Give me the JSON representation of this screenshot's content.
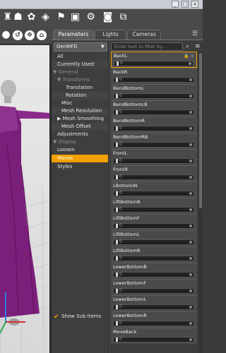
{
  "window_buttons": [
    "_",
    "□",
    "×"
  ],
  "tabs": [
    {
      "label": "Parameters"
    },
    {
      "label": "Lights"
    },
    {
      "label": "Cameras"
    }
  ],
  "figure_dropdown": "GenMFD",
  "categories": [
    {
      "label": "All"
    },
    {
      "label": "Currently Used"
    },
    {
      "label": "▼ General"
    },
    {
      "label": "▼ Transforms"
    },
    {
      "label": "Translation"
    },
    {
      "label": "Rotation"
    },
    {
      "label": "Misc"
    },
    {
      "label": "Mesh Resolution"
    },
    {
      "label": "▶ Mesh Smoothing"
    },
    {
      "label": "Mesh Offset"
    },
    {
      "label": "Adjustments"
    },
    {
      "label": "▼ Display"
    },
    {
      "label": "Loosen"
    },
    {
      "label": "Moves"
    },
    {
      "label": "Styles"
    }
  ],
  "show_sub_items": "Show Sub Items",
  "search_placeholder": "Enter text to filter by...",
  "properties": [
    {
      "name": "BackL",
      "value": "0"
    },
    {
      "name": "BackR",
      "value": "0"
    },
    {
      "name": "BendBottomL",
      "value": "0"
    },
    {
      "name": "BendBottomLB",
      "value": "0"
    },
    {
      "name": "BendBottomR",
      "value": "0"
    },
    {
      "name": "BendBottomRB",
      "value": "0"
    },
    {
      "name": "FrontL",
      "value": "0"
    },
    {
      "name": "FrontR",
      "value": "0"
    },
    {
      "name": "LBottomIN",
      "value": "0"
    },
    {
      "name": "LiftBottomB",
      "value": "0"
    },
    {
      "name": "LiftBottomF",
      "value": "0"
    },
    {
      "name": "LiftBottomL",
      "value": "0"
    },
    {
      "name": "LiftBottomR",
      "value": "0"
    },
    {
      "name": "LowerBottomB",
      "value": "0"
    },
    {
      "name": "LowerBottomF",
      "value": "0"
    },
    {
      "name": "LowerBottomL",
      "value": "0"
    },
    {
      "name": "LowerBottomR",
      "value": "0"
    },
    {
      "name": "MoveBack",
      "value": "0"
    }
  ],
  "colors": {
    "accent": "#f0a000",
    "dress": "#7a1f7a",
    "panel": "#4d4d4d"
  }
}
